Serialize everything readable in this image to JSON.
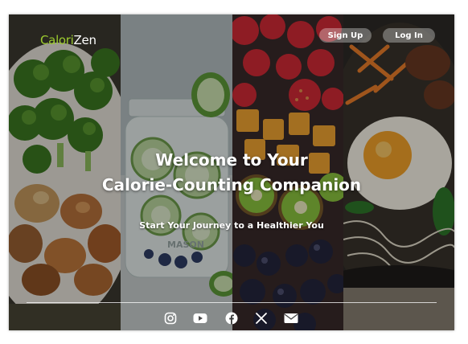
{
  "brand": {
    "logo_part1": "Calori",
    "logo_part2": "Zen"
  },
  "nav": {
    "signup_label": "Sign Up",
    "login_label": "Log In"
  },
  "hero": {
    "title_line1": "Welcome to Your",
    "title_line2": "Calorie-Counting Companion",
    "subtitle": "Start Your Journey to a Healthier You"
  },
  "jar_text": "MASON",
  "social_icons": [
    "instagram-icon",
    "youtube-icon",
    "facebook-icon",
    "x-icon",
    "mail-icon"
  ],
  "colors": {
    "logo_accent": "#9ccb2f",
    "text": "#ffffff"
  }
}
